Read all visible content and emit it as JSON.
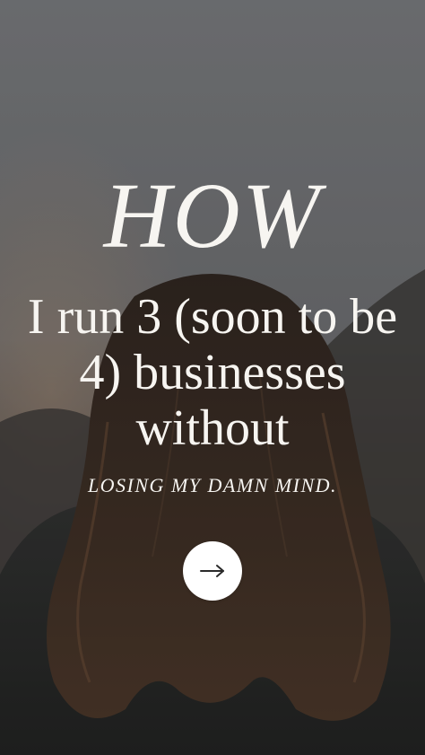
{
  "hero": {
    "title_how": "HOW",
    "title_main": "I run 3 (soon to be 4) businesses without",
    "tagline": "LOSING MY DAMN MIND.",
    "photo_subject": "woman-with-long-wavy-hair-from-behind"
  },
  "next_button": {
    "icon": "arrow-right-icon",
    "background_color": "#ffffff",
    "icon_color": "#2a2a2a"
  },
  "colors": {
    "text": "#f7f5f1",
    "sky": "#7a7c7f",
    "hair": "#3a2a20",
    "jacket": "#2b2b2a"
  }
}
